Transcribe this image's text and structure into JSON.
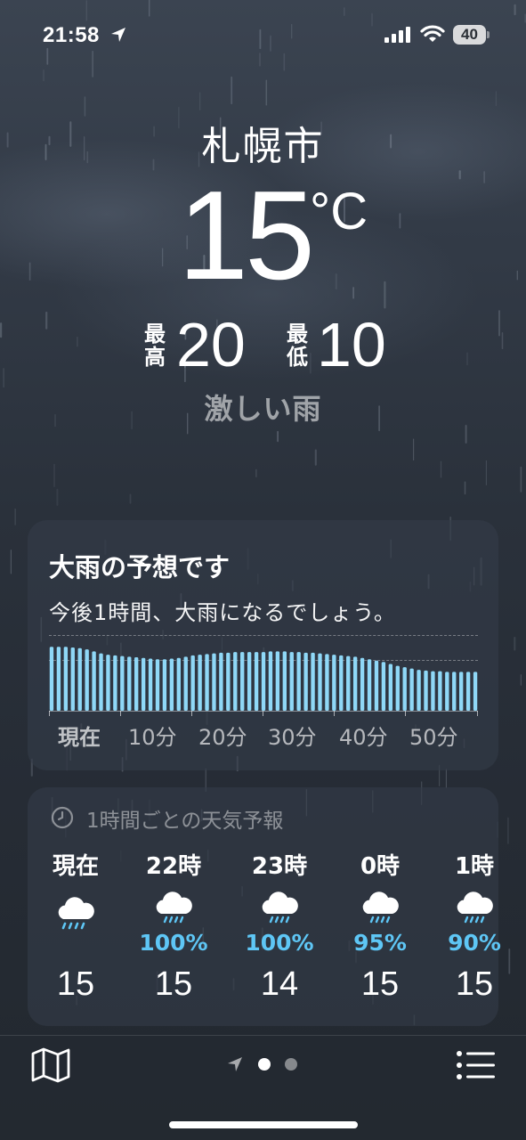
{
  "status_bar": {
    "time": "21:58",
    "battery_level": "40",
    "icons": [
      "location-arrow-icon",
      "cellular-signal-icon",
      "wifi-icon",
      "battery-icon"
    ]
  },
  "header": {
    "city": "札幌市",
    "temperature": "15",
    "unit": "°C",
    "high_label": "最高",
    "high_value": "20",
    "low_label": "最低",
    "low_value": "10",
    "condition": "激しい雨"
  },
  "precipitation": {
    "title": "大雨の予想です",
    "subtitle": "今後1時間、大雨になるでしょう。",
    "bar_color": "#8fd8f7",
    "axis_labels": [
      "現在",
      "10分",
      "20分",
      "30分",
      "40分",
      "50分"
    ],
    "intensity": [
      0.97,
      0.97,
      0.97,
      0.96,
      0.95,
      0.93,
      0.9,
      0.87,
      0.85,
      0.84,
      0.83,
      0.82,
      0.81,
      0.8,
      0.79,
      0.78,
      0.78,
      0.79,
      0.8,
      0.82,
      0.84,
      0.85,
      0.86,
      0.87,
      0.88,
      0.88,
      0.89,
      0.89,
      0.89,
      0.89,
      0.89,
      0.9,
      0.9,
      0.9,
      0.89,
      0.89,
      0.88,
      0.88,
      0.87,
      0.86,
      0.85,
      0.84,
      0.83,
      0.82,
      0.8,
      0.78,
      0.76,
      0.74,
      0.71,
      0.68,
      0.66,
      0.64,
      0.62,
      0.61,
      0.6,
      0.6,
      0.59,
      0.59,
      0.59,
      0.59,
      0.59
    ]
  },
  "hourly": {
    "title": "1時間ごとの天気予報",
    "items": [
      {
        "time": "現在",
        "icon": "heavy-rain-cloud-icon",
        "pop": "",
        "temp": "15"
      },
      {
        "time": "22時",
        "icon": "rain-cloud-icon",
        "pop": "100%",
        "temp": "15"
      },
      {
        "time": "23時",
        "icon": "rain-cloud-icon",
        "pop": "100%",
        "temp": "14"
      },
      {
        "time": "0時",
        "icon": "rain-cloud-icon",
        "pop": "95%",
        "temp": "15"
      },
      {
        "time": "1時",
        "icon": "rain-cloud-icon",
        "pop": "90%",
        "temp": "15"
      }
    ]
  },
  "tabbar": {
    "icons": [
      "map-icon",
      "location-arrow-icon",
      "page-dot-icon",
      "list-icon"
    ],
    "current_page": 1,
    "page_count": 2
  }
}
